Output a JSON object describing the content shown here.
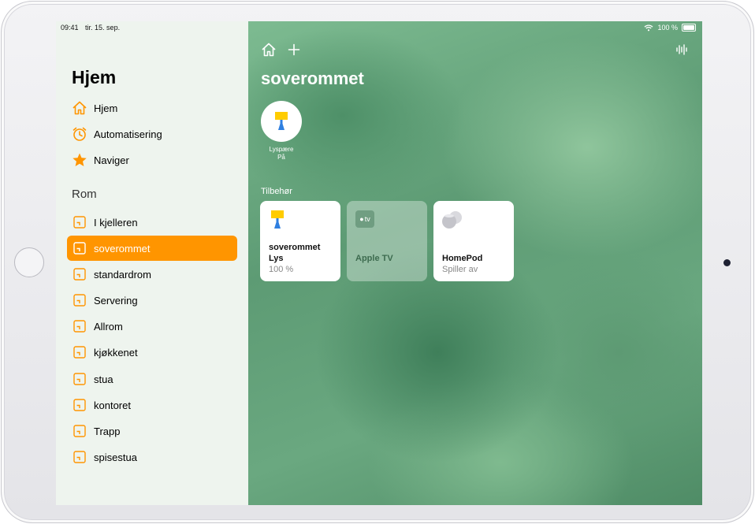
{
  "status_bar": {
    "time": "09:41",
    "date": "tir. 15. sep.",
    "battery": "100 %"
  },
  "sidebar": {
    "title": "Hjem",
    "nav": [
      {
        "label": "Hjem",
        "icon": "house-icon"
      },
      {
        "label": "Automatisering",
        "icon": "clock-icon"
      },
      {
        "label": "Naviger",
        "icon": "star-icon"
      }
    ],
    "rooms_title": "Rom",
    "rooms": [
      {
        "label": "I kjelleren"
      },
      {
        "label": "soverommet"
      },
      {
        "label": "standardrom"
      },
      {
        "label": "Servering"
      },
      {
        "label": "Allrom"
      },
      {
        "label": "kjøkkenet"
      },
      {
        "label": "stua"
      },
      {
        "label": "kontoret"
      },
      {
        "label": "Trapp"
      },
      {
        "label": "spisestua"
      }
    ],
    "selected_room": "soverommet"
  },
  "main": {
    "title": "soverommet",
    "scene": {
      "label_line1": "Lyspære",
      "label_line2": "På",
      "icon": "lamp-icon"
    },
    "accessories_title": "Tilbehør",
    "accessories": [
      {
        "name_line1": "soverommet",
        "name_line2": "Lys",
        "status": "100 %",
        "icon": "lamp-icon"
      },
      {
        "name": "Apple TV",
        "icon_text": "tv",
        "icon": "apple-tv-icon"
      },
      {
        "name": "HomePod",
        "status": "Spiller av",
        "icon": "homepod-icon"
      }
    ]
  },
  "colors": {
    "accent": "#ff9500",
    "icon_orange": "#ff9500"
  }
}
